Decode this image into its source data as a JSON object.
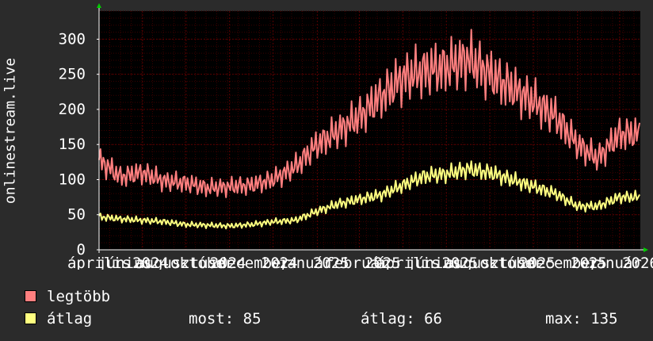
{
  "chart_data": {
    "type": "line",
    "ylabel": "onlinestream.live",
    "ylim": [
      0,
      340
    ],
    "yticks": [
      0,
      50,
      100,
      150,
      200,
      250,
      300
    ],
    "x_start": "2024-04-01",
    "x_end": "2026-04-30",
    "xtick_labels": [
      "április",
      "június",
      "2024",
      "augusztus",
      "október",
      "2024",
      "december",
      "2024",
      "január",
      "2025",
      "február",
      "2025",
      "április",
      "június",
      "2025",
      "augusztus",
      "október",
      "2025",
      "december",
      "2025",
      "január",
      "2026"
    ],
    "grid": true,
    "colors": {
      "background": "#000000",
      "grid": "#5a0000",
      "axis": "#ffffff",
      "arrow": "#00cc00"
    },
    "series": [
      {
        "name": "legtöbb",
        "color": "#ff7f7f",
        "points": [
          [
            "2024-04-01",
            128
          ],
          [
            "2024-05-01",
            104
          ],
          [
            "2024-06-01",
            110
          ],
          [
            "2024-07-01",
            98
          ],
          [
            "2024-08-01",
            95
          ],
          [
            "2024-09-01",
            88
          ],
          [
            "2024-10-01",
            90
          ],
          [
            "2024-11-01",
            92
          ],
          [
            "2024-12-01",
            100
          ],
          [
            "2025-01-01",
            118
          ],
          [
            "2025-02-01",
            150
          ],
          [
            "2025-03-01",
            168
          ],
          [
            "2025-04-01",
            190
          ],
          [
            "2025-05-01",
            218
          ],
          [
            "2025-06-01",
            245
          ],
          [
            "2025-07-01",
            255
          ],
          [
            "2025-08-01",
            260
          ],
          [
            "2025-09-01",
            272
          ],
          [
            "2025-10-01",
            250
          ],
          [
            "2025-11-01",
            230
          ],
          [
            "2025-12-01",
            212
          ],
          [
            "2026-01-01",
            190
          ],
          [
            "2026-02-01",
            150
          ],
          [
            "2026-03-01",
            130
          ],
          [
            "2026-04-01",
            165
          ]
        ]
      },
      {
        "name": "átlag",
        "color": "#ffff80",
        "points": [
          [
            "2024-04-01",
            47
          ],
          [
            "2024-05-01",
            44
          ],
          [
            "2024-06-01",
            42
          ],
          [
            "2024-07-01",
            40
          ],
          [
            "2024-08-01",
            36
          ],
          [
            "2024-09-01",
            35
          ],
          [
            "2024-10-01",
            34
          ],
          [
            "2024-11-01",
            36
          ],
          [
            "2024-12-01",
            40
          ],
          [
            "2025-01-01",
            42
          ],
          [
            "2025-02-01",
            55
          ],
          [
            "2025-03-01",
            65
          ],
          [
            "2025-04-01",
            72
          ],
          [
            "2025-05-01",
            78
          ],
          [
            "2025-06-01",
            92
          ],
          [
            "2025-07-01",
            105
          ],
          [
            "2025-08-01",
            108
          ],
          [
            "2025-09-01",
            115
          ],
          [
            "2025-10-01",
            110
          ],
          [
            "2025-11-01",
            100
          ],
          [
            "2025-12-01",
            90
          ],
          [
            "2026-01-01",
            80
          ],
          [
            "2026-02-01",
            62
          ],
          [
            "2026-03-01",
            62
          ],
          [
            "2026-04-01",
            75
          ]
        ]
      }
    ]
  },
  "legend": [
    {
      "label": "legtöbb",
      "color": "#ff7f7f"
    },
    {
      "label": "átlag",
      "color": "#ffff80"
    }
  ],
  "stats": {
    "most": "most: 85",
    "atlag": "átlag: 66",
    "max": "max: 135"
  }
}
